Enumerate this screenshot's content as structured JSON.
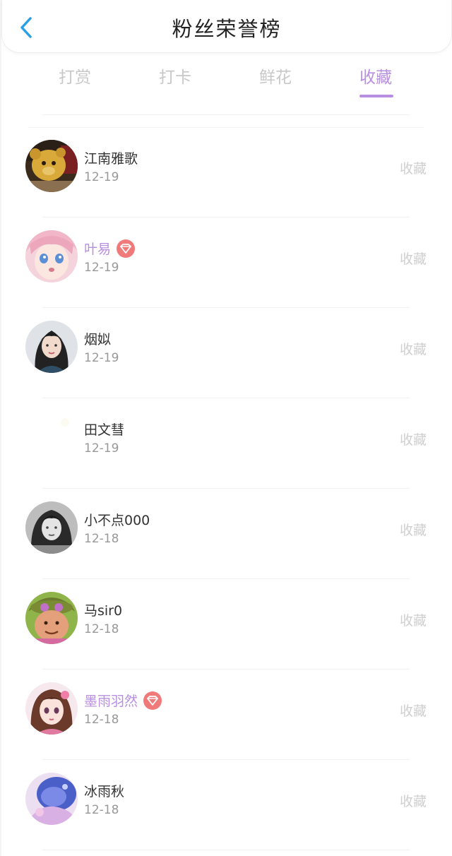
{
  "header": {
    "title": "粉丝荣誉榜"
  },
  "tabs": [
    {
      "label": "打赏"
    },
    {
      "label": "打卡"
    },
    {
      "label": "鲜花"
    },
    {
      "label": "收藏"
    }
  ],
  "colors": {
    "accent": "#b88fe0",
    "vip_badge": "#f07a7a",
    "back_icon": "#2b9fe6"
  },
  "fans": [
    {
      "name": "江南雅歌",
      "date": "12-19",
      "action": "收藏",
      "vip": false,
      "avatar_icon": "bear-photo-avatar"
    },
    {
      "name": "叶易",
      "date": "12-19",
      "action": "收藏",
      "vip": true,
      "avatar_icon": "anime-girl-avatar"
    },
    {
      "name": "烟姒",
      "date": "12-19",
      "action": "收藏",
      "vip": false,
      "avatar_icon": "woman-photo-avatar"
    },
    {
      "name": "田文彗",
      "date": "12-19",
      "action": "收藏",
      "vip": false,
      "avatar_icon": "blank-avatar"
    },
    {
      "name": "小不点000",
      "date": "12-18",
      "action": "收藏",
      "vip": false,
      "avatar_icon": "bw-portrait-avatar"
    },
    {
      "name": "马sir0",
      "date": "12-18",
      "action": "收藏",
      "vip": false,
      "avatar_icon": "game-character-avatar"
    },
    {
      "name": "墨雨羽然",
      "date": "12-18",
      "action": "收藏",
      "vip": true,
      "avatar_icon": "anime-girl-avatar"
    },
    {
      "name": "冰雨秋",
      "date": "12-18",
      "action": "收藏",
      "vip": false,
      "avatar_icon": "blue-art-avatar"
    }
  ]
}
